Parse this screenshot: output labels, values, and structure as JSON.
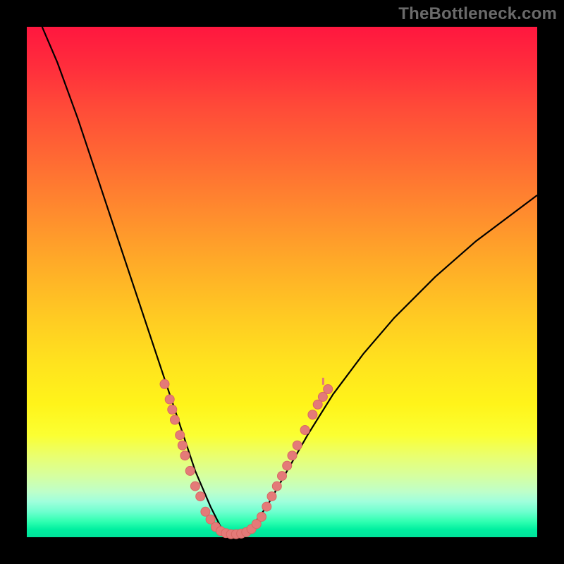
{
  "watermark": "TheBottleneck.com",
  "colors": {
    "frame": "#000000",
    "curve": "#000000",
    "dot": "#e47a78"
  },
  "chart_data": {
    "type": "line",
    "title": "",
    "xlabel": "",
    "ylabel": "",
    "xlim": [
      0,
      100
    ],
    "ylim": [
      0,
      100
    ],
    "curve": {
      "description": "Bottleneck curve: high at left, descends steeply to a minimum near x≈40, then rises more gradually to the right edge.",
      "points": [
        {
          "x": 3,
          "y": 100
        },
        {
          "x": 6,
          "y": 93
        },
        {
          "x": 10,
          "y": 82
        },
        {
          "x": 14,
          "y": 70
        },
        {
          "x": 18,
          "y": 58
        },
        {
          "x": 22,
          "y": 46
        },
        {
          "x": 26,
          "y": 34
        },
        {
          "x": 30,
          "y": 22
        },
        {
          "x": 33,
          "y": 13
        },
        {
          "x": 36,
          "y": 6
        },
        {
          "x": 38,
          "y": 2
        },
        {
          "x": 40,
          "y": 0.5
        },
        {
          "x": 42,
          "y": 0.5
        },
        {
          "x": 44,
          "y": 2
        },
        {
          "x": 47,
          "y": 6
        },
        {
          "x": 51,
          "y": 13
        },
        {
          "x": 55,
          "y": 20
        },
        {
          "x": 60,
          "y": 28
        },
        {
          "x": 66,
          "y": 36
        },
        {
          "x": 72,
          "y": 43
        },
        {
          "x": 80,
          "y": 51
        },
        {
          "x": 88,
          "y": 58
        },
        {
          "x": 96,
          "y": 64
        },
        {
          "x": 100,
          "y": 67
        }
      ]
    },
    "series": [
      {
        "name": "markers",
        "type": "scatter",
        "values": [
          {
            "x": 27,
            "y": 30
          },
          {
            "x": 28,
            "y": 27
          },
          {
            "x": 28.5,
            "y": 25
          },
          {
            "x": 29,
            "y": 23
          },
          {
            "x": 30,
            "y": 20
          },
          {
            "x": 30.5,
            "y": 18
          },
          {
            "x": 31,
            "y": 16
          },
          {
            "x": 32,
            "y": 13
          },
          {
            "x": 33,
            "y": 10
          },
          {
            "x": 34,
            "y": 8
          },
          {
            "x": 35,
            "y": 5
          },
          {
            "x": 36,
            "y": 3.5
          },
          {
            "x": 37,
            "y": 2
          },
          {
            "x": 38,
            "y": 1.2
          },
          {
            "x": 39,
            "y": 0.8
          },
          {
            "x": 40,
            "y": 0.6
          },
          {
            "x": 41,
            "y": 0.6
          },
          {
            "x": 42,
            "y": 0.7
          },
          {
            "x": 43,
            "y": 1
          },
          {
            "x": 44,
            "y": 1.6
          },
          {
            "x": 45,
            "y": 2.6
          },
          {
            "x": 46,
            "y": 4
          },
          {
            "x": 47,
            "y": 6
          },
          {
            "x": 48,
            "y": 8
          },
          {
            "x": 49,
            "y": 10
          },
          {
            "x": 50,
            "y": 12
          },
          {
            "x": 51,
            "y": 14
          },
          {
            "x": 52,
            "y": 16
          },
          {
            "x": 53,
            "y": 18
          },
          {
            "x": 54.5,
            "y": 21
          },
          {
            "x": 56,
            "y": 24
          },
          {
            "x": 57,
            "y": 26
          },
          {
            "x": 58,
            "y": 27.5
          },
          {
            "x": 59,
            "y": 29
          }
        ]
      }
    ],
    "small_mark": {
      "x": 58,
      "y": 30,
      "note": "tiny tick above right arm of curve"
    }
  }
}
